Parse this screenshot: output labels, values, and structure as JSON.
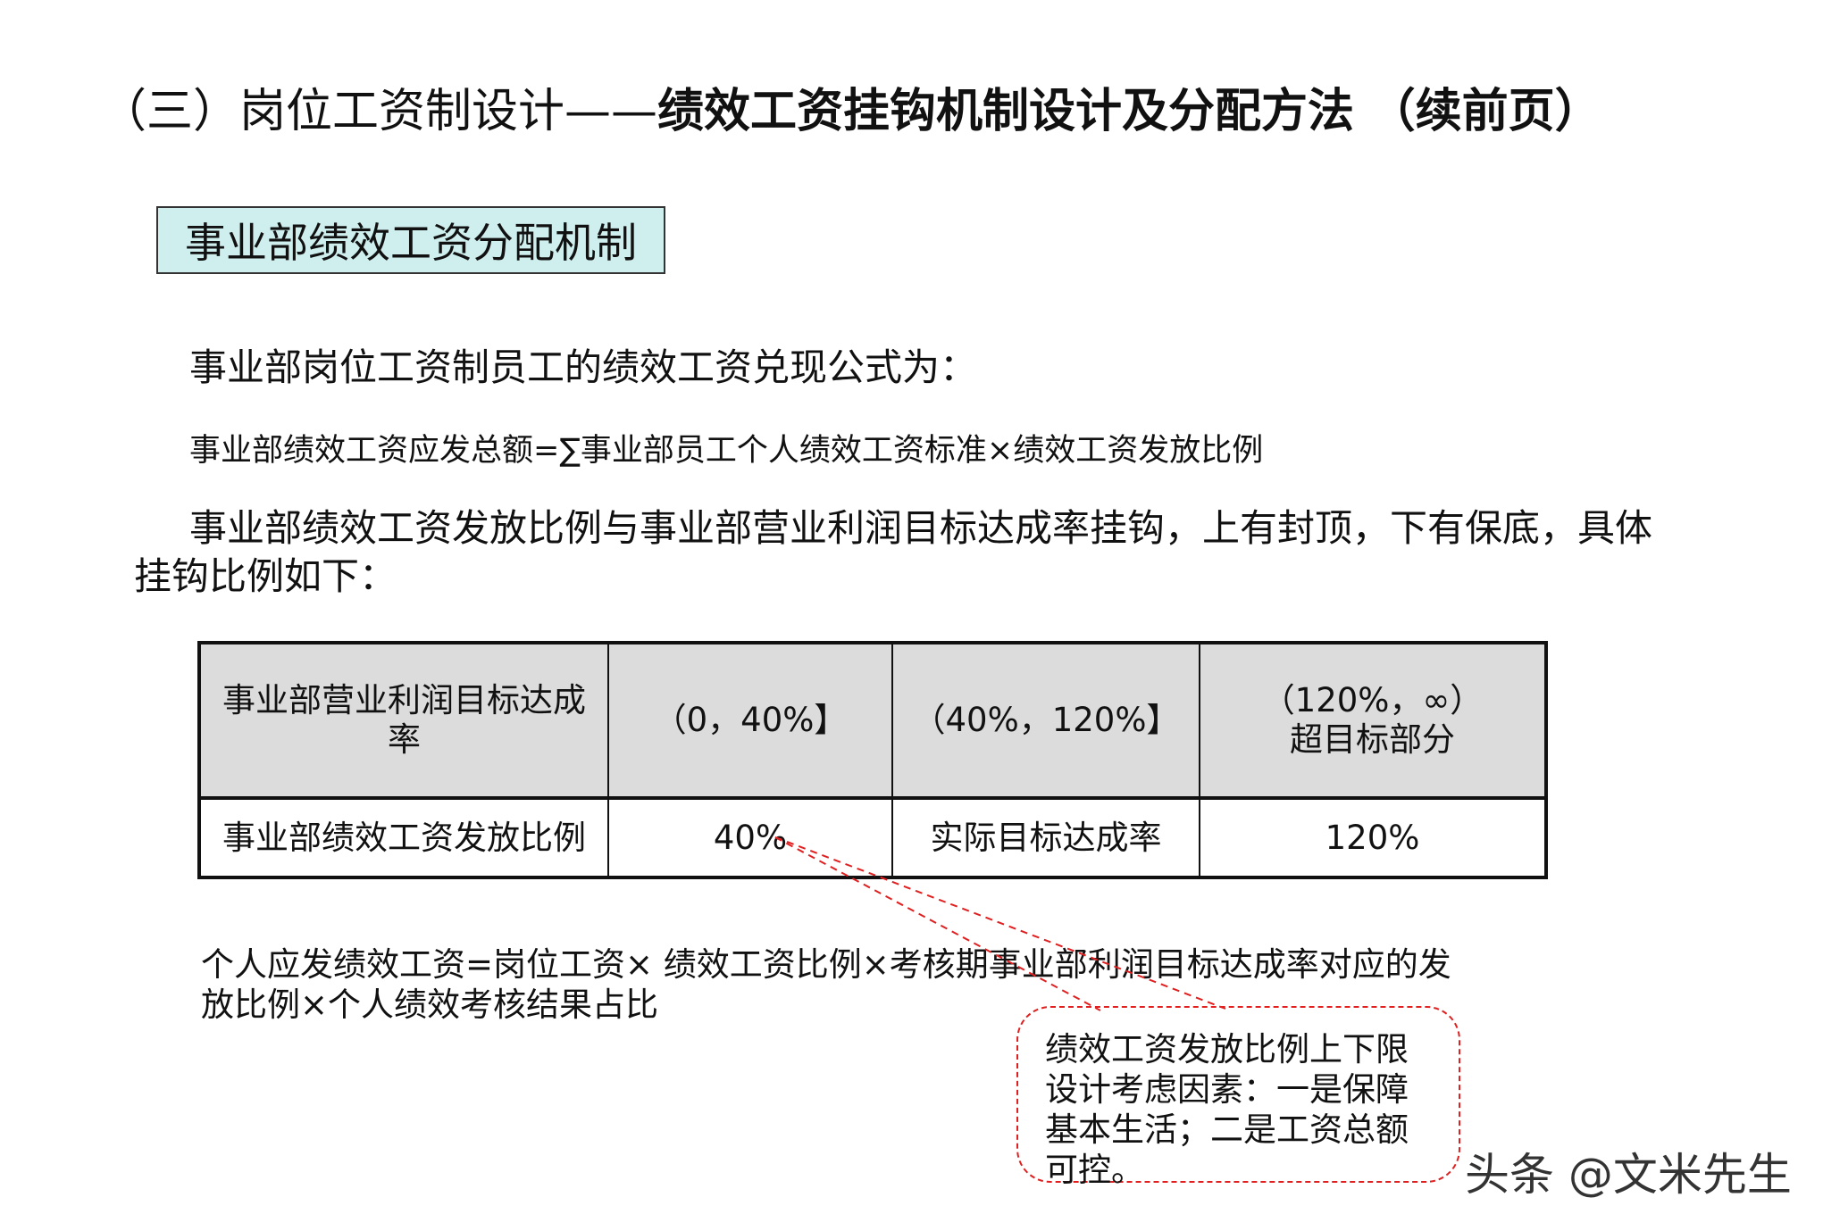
{
  "title": {
    "prefix": "（三）岗位工资制设计——",
    "bold": "绩效工资挂钩机制设计及分配方法",
    "suffix": "（续前页）"
  },
  "section_label": "事业部绩效工资分配机制",
  "intro": "事业部岗位工资制员工的绩效工资兑现公式为：",
  "formula": "事业部绩效工资应发总额=∑事业部员工个人绩效工资标准×绩效工资发放比例",
  "paragraph": "事业部绩效工资发放比例与事业部营业利润目标达成率挂钩，上有封顶，下有保底，具体挂钩比例如下：",
  "table": {
    "header": {
      "label": "事业部营业利润目标达成率",
      "c1": "（0，40%】",
      "c2": "（40%，120%】",
      "c3_line1": "（120%，∞）",
      "c3_line2": "超目标部分"
    },
    "row": {
      "label": "事业部绩效工资发放比例",
      "c1": "40%",
      "c2": "实际目标达成率",
      "c3": "120%"
    }
  },
  "note": "个人应发绩效工资=岗位工资× 绩效工资比例×考核期事业部利润目标达成率对应的发放比例×个人绩效考核结果占比",
  "callout": "绩效工资发放比例上下限设计考虑因素：一是保障基本生活；二是工资总额可控。",
  "watermark": "头条 @文米先生",
  "colors": {
    "section_bg": "#cfeeee",
    "table_header_bg": "#dcdcdc",
    "callout_border": "#e02020"
  }
}
